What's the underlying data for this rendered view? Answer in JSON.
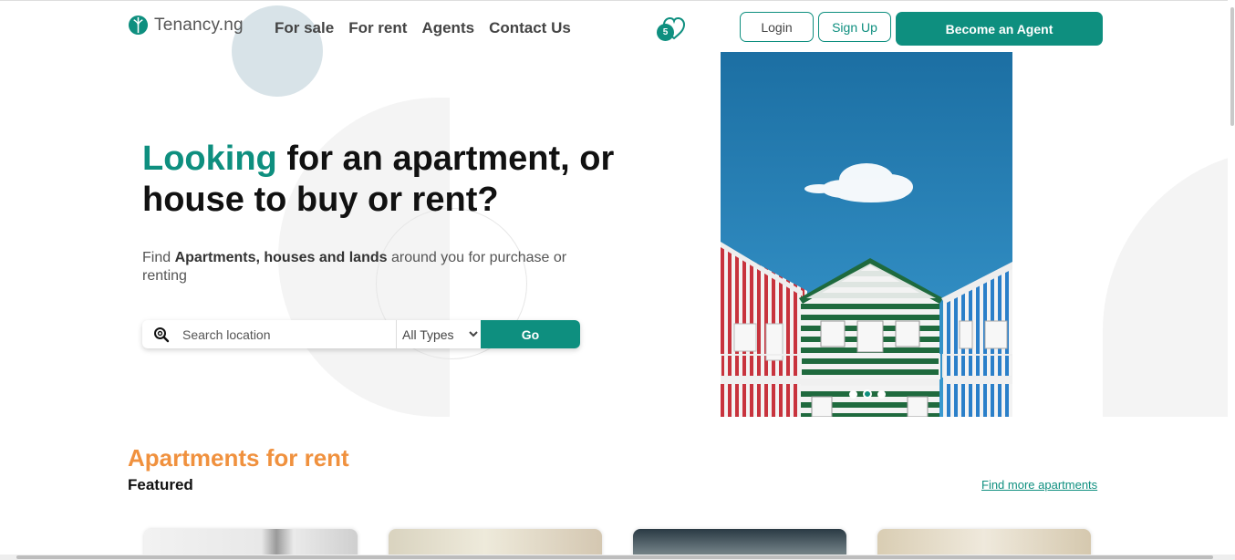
{
  "brand": {
    "name": "Tenancy.ng",
    "color": "#0e8f7f"
  },
  "nav": [
    {
      "label": "For sale"
    },
    {
      "label": "For rent"
    },
    {
      "label": "Agents"
    },
    {
      "label": "Contact Us"
    }
  ],
  "favorites": {
    "icon": "heart-icon",
    "count": "5"
  },
  "auth": {
    "login": "Login",
    "signup": "Sign Up",
    "agent": "Become an Agent"
  },
  "hero": {
    "title_accent": "Looking",
    "title_rest": " for an apartment, or house to buy or rent?",
    "sub_prefix": "Find ",
    "sub_bold": "Apartments, houses and lands",
    "sub_suffix": " around you for purchase or renting"
  },
  "search": {
    "icon": "search-icon",
    "placeholder": "Search location",
    "type_selected": "All Types",
    "go_label": "Go"
  },
  "carousel": {
    "slide_count": 3,
    "active_index": 1
  },
  "section": {
    "title": "Apartments for rent",
    "subtitle": "Featured",
    "more_link": "Find more apartments"
  },
  "colors": {
    "accent": "#0e8f7f",
    "section_title": "#f0913e"
  }
}
